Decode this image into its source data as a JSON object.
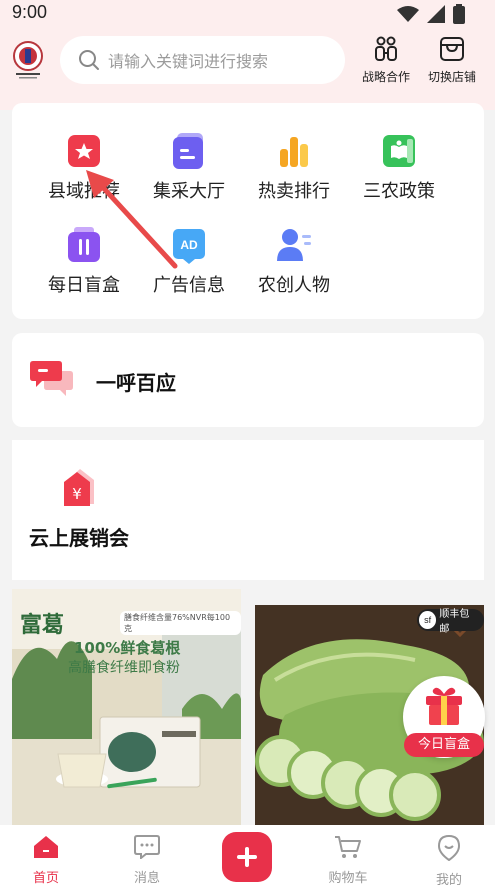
{
  "status": {
    "time": "9:00"
  },
  "header": {
    "search_placeholder": "请输入关键词进行搜索",
    "strategic_label": "战略合作",
    "switch_store_label": "切换店铺"
  },
  "grid": {
    "items": [
      {
        "label": "县域推荐",
        "icon": "red-star-folder-icon",
        "color": "#ee3b4c"
      },
      {
        "label": "集采大厅",
        "icon": "purple-card-icon",
        "color": "#6d5ff0"
      },
      {
        "label": "热卖排行",
        "icon": "bar-chart-icon",
        "color": "#f5a623"
      },
      {
        "label": "三农政策",
        "icon": "green-book-icon",
        "color": "#37c25a"
      },
      {
        "label": "每日盲盒",
        "icon": "purple-box-icon",
        "color": "#8b53f0"
      },
      {
        "label": "广告信息",
        "icon": "ad-icon",
        "color": "#47a8f6"
      },
      {
        "label": "农创人物",
        "icon": "person-icon",
        "color": "#5b7cf5"
      }
    ]
  },
  "yihu": {
    "title": "一呼百应"
  },
  "cloud": {
    "title": "云上展销会"
  },
  "products": {
    "p1": {
      "brand": "富葛",
      "top_note": "膳食纤维含量76%NVR每100克",
      "headline1": "100%鲜食葛根",
      "headline2": "高膳食纤维即食粉"
    },
    "p2": {
      "badge": "顺丰包邮"
    }
  },
  "gift": {
    "label": "今日盲盒"
  },
  "nav": {
    "home": "首页",
    "messages": "消息",
    "cart": "购物车",
    "mine": "我的"
  },
  "colors": {
    "accent": "#e8314a",
    "header_bg": "#fdeeee"
  }
}
